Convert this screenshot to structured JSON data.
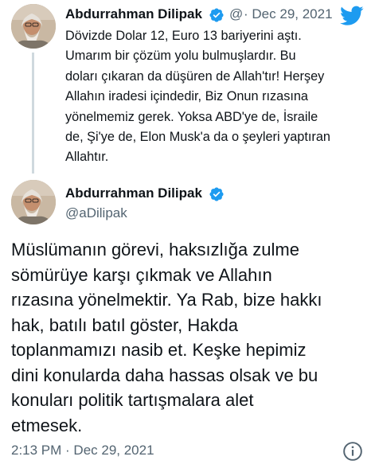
{
  "reply_tweet": {
    "author_name": "Abdurrahman Dilipak",
    "handle_truncated": "@",
    "separator": "·",
    "date": "Dec 29, 2021",
    "text_lines": [
      "Dövizde Dolar 12, Euro 13 bariyerini aştı.",
      "Umarım bir çözüm yolu bulmuşlardır. Bu",
      "doları çıkaran da düşüren de Allah'tır! Herşey",
      "Allahın iradesi içindedir, Biz Onun rızasına",
      "yönelmemiz gerek. Yoksa ABD'ye de, İsraile",
      "de, Şi'ye de, Elon Musk'a da o şeyleri yaptıran",
      "Allahtır."
    ]
  },
  "main_tweet": {
    "author_name": "Abdurrahman Dilipak",
    "handle": "@aDilipak",
    "text_lines": [
      "Müslümanın görevi, haksızlığa zulme",
      "sömürüye karşı çıkmak ve Allahın",
      "rızasına yönelmektir. Ya Rab, bize hakkı",
      "hak, batılı batıl göster, Hakda",
      "toplanmamızı nasib et. Keşke hepimiz",
      "dini konularda daha hassas olsak ve bu",
      "konuları politik tartışmalara alet",
      "etmesek."
    ],
    "timestamp": "2:13 PM · Dec 29, 2021"
  },
  "icons": {
    "verified": "verified-badge-icon",
    "brand": "twitter-bird-icon",
    "info": "info-icon"
  },
  "colors": {
    "brand_blue": "#1d9bf0",
    "text_primary": "#0f1419",
    "text_secondary": "#536471",
    "thread_line": "#cfd9de"
  }
}
